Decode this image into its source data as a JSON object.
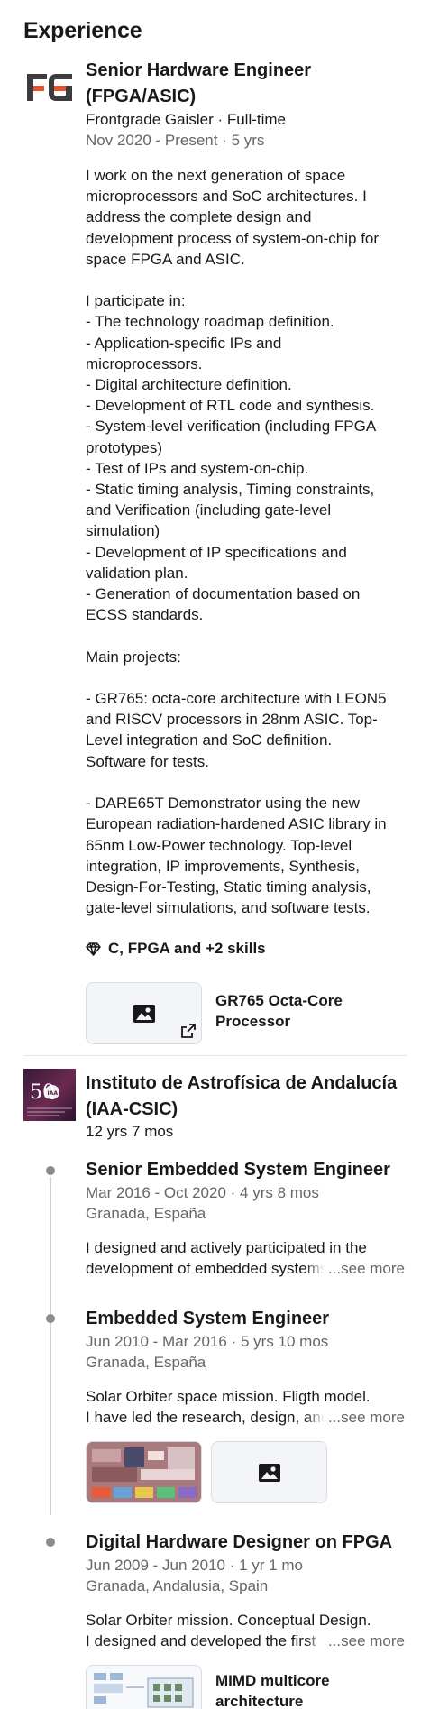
{
  "section": {
    "title": "Experience"
  },
  "job1": {
    "logo_text": "FG",
    "title": "Senior Hardware Engineer (FPGA/ASIC)",
    "title_line1": "Senior Hardware Engineer",
    "title_line2": "(FPGA/ASIC)",
    "company_type": "Frontgrade Gaisler · Full-time",
    "dates": "Nov 2020 - Present · 5 yrs",
    "description": "I work on the next generation of space\nmicroprocessors and SoC architectures. I\naddress the complete design and\ndevelopment process of system-on-chip for\nspace FPGA and ASIC.\n\nI participate in:\n- The technology roadmap definition.\n- Application-specific IPs and\nmicroprocessors.\n- Digital architecture definition.\n- Development of RTL code and synthesis.\n- System-level verification (including FPGA\nprototypes)\n- Test of IPs and system-on-chip.\n- Static timing analysis, Timing constraints,\nand Verification (including gate-level\nsimulation)\n- Development of IP specifications and\nvalidation plan.\n- Generation of documentation based on\nECSS standards.\n\nMain projects:\n\n- GR765: octa-core architecture with LEON5\nand RISCV processors in 28nm ASIC. Top-\nLevel integration and SoC definition.\nSoftware for tests.\n\n- DARE65T Demonstrator using the new\nEuropean radiation-hardened ASIC library in\n65nm Low-Power technology. Top-level\nintegration, IP improvements, Synthesis,\nDesign-For-Testing, Static timing analysis,\ngate-level simulations, and software tests.",
    "skills": "C, FPGA and +2 skills",
    "media_label_line1": "GR765 Octa-Core",
    "media_label_line2": "Processor"
  },
  "company2": {
    "name_line1": "Instituto de Astrofísica de Andalucía",
    "name_line2": "(IAA-CSIC)",
    "logo_text": "IAA",
    "logo_number": "50",
    "duration": "12 yrs 7 mos",
    "roles": [
      {
        "title": "Senior Embedded System Engineer",
        "dates": "Mar 2016 - Oct 2020 · 4 yrs 8 mos",
        "location": "Granada, España",
        "desc_line1": "I designed and actively participated in the",
        "desc_line2": "development of embedded systems",
        "see_more": "...see more"
      },
      {
        "title": "Embedded System Engineer",
        "dates": "Jun 2010 - Mar 2016 · 5 yrs 10 mos",
        "location": "Granada, España",
        "desc_line1": "Solar Orbiter space mission. Fligth model.",
        "desc_line2": "I have led the research, design, and",
        "see_more": "...see more"
      },
      {
        "title": "Digital Hardware Designer on FPGA",
        "dates": "Jun 2009 - Jun 2010 · 1 yr 1 mo",
        "location": "Granada, Andalusia, Spain",
        "desc_line1": "Solar Orbiter mission. Conceptual Design.",
        "desc_line2": "I designed and developed the first",
        "see_more": "...see more",
        "media_label_line1": "MIMD multicore",
        "media_label_line2": "architecture"
      }
    ]
  },
  "icons": {
    "skills": "diamond-icon",
    "media_placeholder": "image-icon",
    "external": "external-link-icon"
  },
  "colors": {
    "text": "#191919",
    "muted": "#666666",
    "fg_orange": "#e8542a",
    "fg_dark": "#3b3b3b"
  }
}
